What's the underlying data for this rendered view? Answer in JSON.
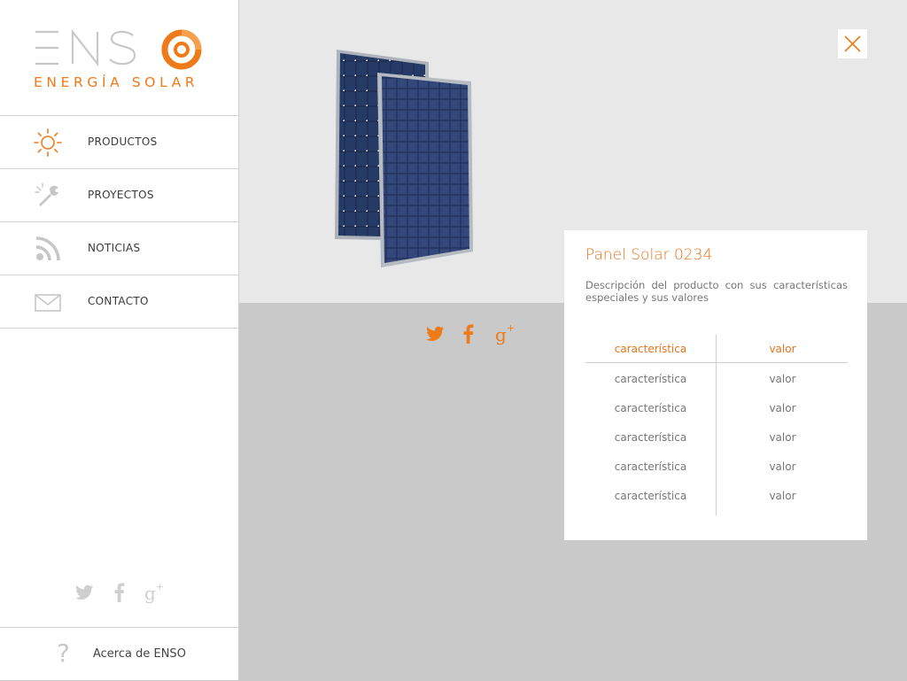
{
  "brand": {
    "wordmark": "ENSO",
    "tagline": "ENERGÍA SOLAR",
    "accent_color": "#ef7a1a"
  },
  "nav": {
    "items": [
      {
        "label": "PRODUCTOS",
        "icon": "sun-icon"
      },
      {
        "label": "PROYECTOS",
        "icon": "tools-icon"
      },
      {
        "label": "NOTICIAS",
        "icon": "rss-icon"
      },
      {
        "label": "CONTACTO",
        "icon": "mail-icon"
      }
    ]
  },
  "sidebar_social": [
    "twitter-icon",
    "facebook-icon",
    "google-plus-icon"
  ],
  "about": {
    "label": "Acerca de ENSO"
  },
  "product": {
    "title": "Panel Solar 0234",
    "description": "Descripción del producto con sus características especiales y sus valores",
    "spec_headers": {
      "name": "característica",
      "value": "valor"
    },
    "specs": [
      {
        "name": "característica",
        "value": "valor"
      },
      {
        "name": "característica",
        "value": "valor"
      },
      {
        "name": "característica",
        "value": "valor"
      },
      {
        "name": "característica",
        "value": "valor"
      },
      {
        "name": "característica",
        "value": "valor"
      }
    ]
  }
}
